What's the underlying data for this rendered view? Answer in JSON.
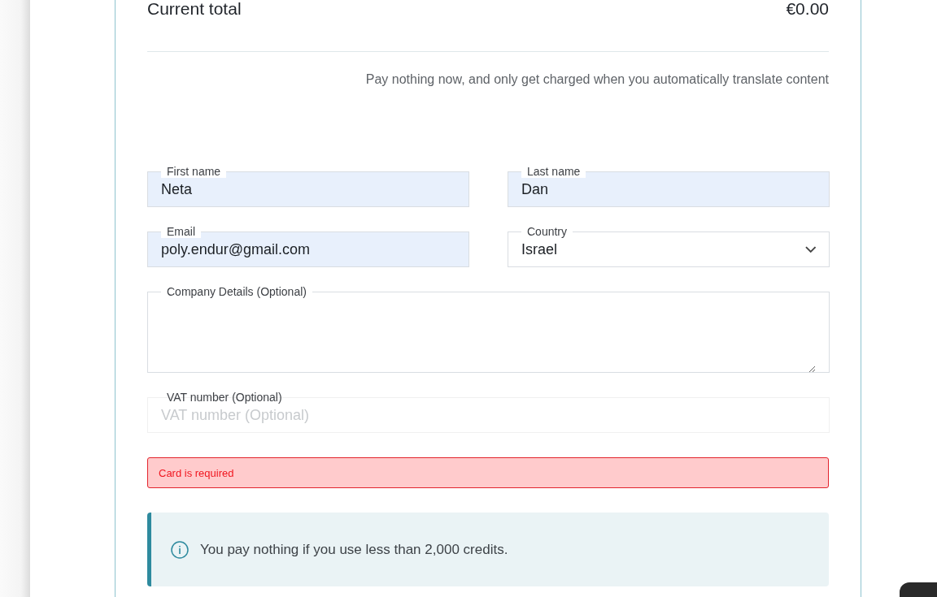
{
  "summary": {
    "title": "Current total",
    "amount": "€0.00",
    "note": "Pay nothing now, and only get charged when you automatically translate content"
  },
  "fields": [
    {
      "kind": "text",
      "label": "First name",
      "value": "Neta",
      "autofilled": true
    },
    {
      "kind": "text",
      "label": "Last name",
      "value": "Dan",
      "autofilled": true
    },
    {
      "kind": "text",
      "label": "Email",
      "value": "poly.endur@gmail.com",
      "autofilled": true
    },
    {
      "kind": "select",
      "label": "Country",
      "value": "Israel",
      "autofilled": false
    },
    {
      "kind": "textarea",
      "label": "Company Details (Optional)",
      "autofilled": false
    },
    {
      "kind": "text",
      "label": "VAT number (Optional)",
      "placeholder": "VAT number (Optional)",
      "autofilled": false
    }
  ],
  "error": {
    "message": "Card is required"
  },
  "info": {
    "message": "You pay nothing if you use less than 2,000 credits."
  }
}
